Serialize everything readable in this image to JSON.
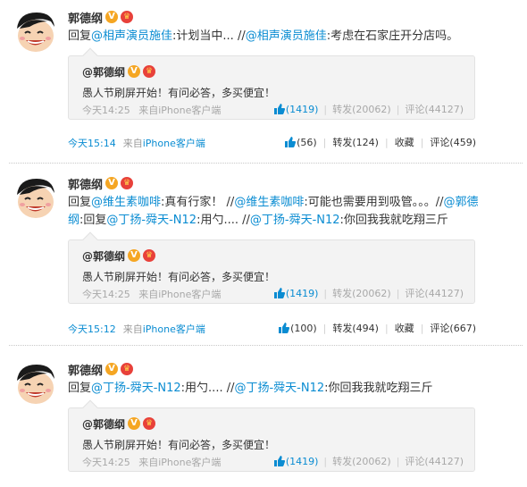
{
  "icons": {
    "verified": "verified-v-icon",
    "member": "crown-member-icon",
    "like": "thumbs-up-icon"
  },
  "colors": {
    "link": "#0a8cd2",
    "muted": "#a8a8a8",
    "quote_bg": "#f3f3f3",
    "verified": "#f5a623",
    "member": "#e8413a"
  },
  "posts": [
    {
      "author": "郭德纲",
      "verified_glyph": "V",
      "member_glyph": "♛",
      "text_parts": [
        {
          "t": "回复"
        },
        {
          "t": "@相声演员施佳",
          "m": true
        },
        {
          "t": ":计划当中... //"
        },
        {
          "t": "@相声演员施佳",
          "m": true
        },
        {
          "t": ":考虑在石家庄开分店吗。"
        }
      ],
      "quote": {
        "author": "@郭德纲",
        "text": "愚人节刷屏开始！有问必答，多买便宜！",
        "time": "今天14:25",
        "source": "来自iPhone客户端",
        "likes": "(1419)",
        "forward": "转发(20062)",
        "comment": "评论(44127)"
      },
      "time": "今天15:14",
      "from_prefix": "来自",
      "client": "iPhone客户端",
      "likes": "(56)",
      "forward": "转发(124)",
      "favorite": "收藏",
      "comment": "评论(459)"
    },
    {
      "author": "郭德纲",
      "verified_glyph": "V",
      "member_glyph": "♛",
      "text_parts": [
        {
          "t": "回复"
        },
        {
          "t": "@维生素咖啡",
          "m": true
        },
        {
          "t": ":真有行家！ //"
        },
        {
          "t": "@维生素咖啡",
          "m": true
        },
        {
          "t": ":可能也需要用到吸管。。。//"
        },
        {
          "t": "@郭德纲",
          "m": true
        },
        {
          "t": ":回复"
        },
        {
          "t": "@丁扬-舜天-N12",
          "m": true
        },
        {
          "t": ":用勺.... //"
        },
        {
          "t": "@丁扬-舜天-N12",
          "m": true
        },
        {
          "t": ":你回我我就吃翔三斤"
        }
      ],
      "quote": {
        "author": "@郭德纲",
        "text": "愚人节刷屏开始！有问必答，多买便宜！",
        "time": "今天14:25",
        "source": "来自iPhone客户端",
        "likes": "(1419)",
        "forward": "转发(20062)",
        "comment": "评论(44127)"
      },
      "time": "今天15:12",
      "from_prefix": "来自",
      "client": "iPhone客户端",
      "likes": "(100)",
      "forward": "转发(494)",
      "favorite": "收藏",
      "comment": "评论(667)"
    },
    {
      "author": "郭德纲",
      "verified_glyph": "V",
      "member_glyph": "♛",
      "text_parts": [
        {
          "t": "回复"
        },
        {
          "t": "@丁扬-舜天-N12",
          "m": true
        },
        {
          "t": ":用勺.... //"
        },
        {
          "t": "@丁扬-舜天-N12",
          "m": true
        },
        {
          "t": ":你回我我就吃翔三斤"
        }
      ],
      "quote": {
        "author": "@郭德纲",
        "text": "愚人节刷屏开始！有问必答，多买便宜！",
        "time": "今天14:25",
        "source": "来自iPhone客户端",
        "likes": "(1419)",
        "forward": "转发(20062)",
        "comment": "评论(44127)"
      }
    }
  ]
}
